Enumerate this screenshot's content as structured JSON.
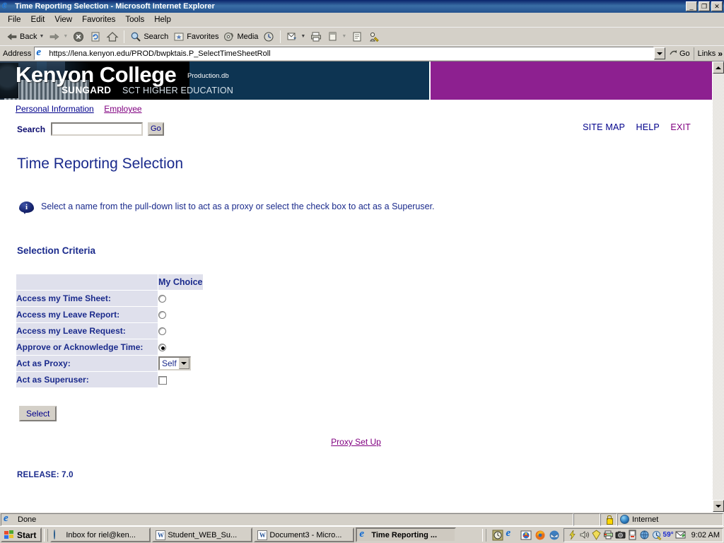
{
  "window": {
    "title": "Time Reporting Selection - Microsoft Internet Explorer",
    "icon": "ie-icon",
    "minimize_label": "_",
    "maximize_label": "❐",
    "close_label": "✕"
  },
  "menubar": {
    "items": [
      "File",
      "Edit",
      "View",
      "Favorites",
      "Tools",
      "Help"
    ]
  },
  "toolbar": {
    "back_label": "Back",
    "forward_label": "",
    "stop_label": "",
    "refresh_label": "",
    "home_label": "",
    "search_label": "Search",
    "favorites_label": "Favorites",
    "media_label": "Media",
    "history_label": "",
    "mail_label": "",
    "print_label": "",
    "edit_label": "",
    "discuss_label": "",
    "messenger_label": ""
  },
  "address": {
    "label": "Address",
    "url": "https://lena.kenyon.edu/PROD/bwpktais.P_SelectTimeSheetRoll",
    "go_label": "Go",
    "links_label": "Links",
    "chevron": "»"
  },
  "banner": {
    "college": "Kenyon College",
    "production": "Production.db",
    "sungard": "SUNGARD",
    "sct": "SCT HIGHER EDUCATION",
    "accent_color": "#8d2090",
    "navy_color": "#0d3452"
  },
  "nav": {
    "items": [
      {
        "label": "Personal Information",
        "state": "unvisited"
      },
      {
        "label": "Employee",
        "state": "visited"
      }
    ]
  },
  "search": {
    "label": "Search",
    "value": "",
    "placeholder": "",
    "go_label": "Go"
  },
  "corner_links": [
    {
      "label": "SITE MAP",
      "state": "unvisited"
    },
    {
      "label": "HELP",
      "state": "unvisited"
    },
    {
      "label": "EXIT",
      "state": "visited"
    }
  ],
  "main": {
    "page_title": "Time Reporting Selection",
    "info_message": "Select a name from the pull-down list to act as a proxy or select the check box to act as a Superuser.",
    "section_title": "Selection Criteria",
    "table": {
      "header_blank": "",
      "header_choice": "My Choice",
      "rows": [
        {
          "label": "Access my Time Sheet:",
          "control": "radio",
          "checked": false
        },
        {
          "label": "Access my Leave Report:",
          "control": "radio",
          "checked": false
        },
        {
          "label": "Access my Leave Request:",
          "control": "radio",
          "checked": false
        },
        {
          "label": "Approve or Acknowledge Time:",
          "control": "radio",
          "checked": true
        },
        {
          "label": "Act as Proxy:",
          "control": "select",
          "value": "Self"
        },
        {
          "label": "Act as Superuser:",
          "control": "checkbox",
          "checked": false
        }
      ]
    },
    "select_button": "Select",
    "proxy_link": "Proxy Set Up",
    "release": "RELEASE: 7.0"
  },
  "statusbar": {
    "message": "Done",
    "zone": "Internet",
    "lock_icon": "padlock-icon",
    "zone_icon": "globe-icon"
  },
  "taskbar": {
    "start_label": "Start",
    "buttons": [
      {
        "label": "Inbox for riel@ken...",
        "icon": "mail-icon",
        "active": false
      },
      {
        "label": "Student_WEB_Su...",
        "icon": "word-icon",
        "active": false
      },
      {
        "label": "Document3 - Micro...",
        "icon": "word-icon",
        "active": false
      },
      {
        "label": "Time Reporting ...",
        "icon": "ie-icon",
        "active": true
      }
    ],
    "quicklaunch": [
      "clock-icon",
      "ie-icon",
      "desktop-icon",
      "firefox-icon",
      "thunderbird-icon"
    ],
    "tray_icons": [
      "power-icon",
      "volume-icon",
      "shield-icon",
      "printer-icon",
      "camera-icon",
      "removable-disk-icon",
      "network-icon",
      "update-icon",
      "weather-icon",
      "mail-tray-icon"
    ],
    "temperature": "59°",
    "clock": "9:02 AM"
  }
}
